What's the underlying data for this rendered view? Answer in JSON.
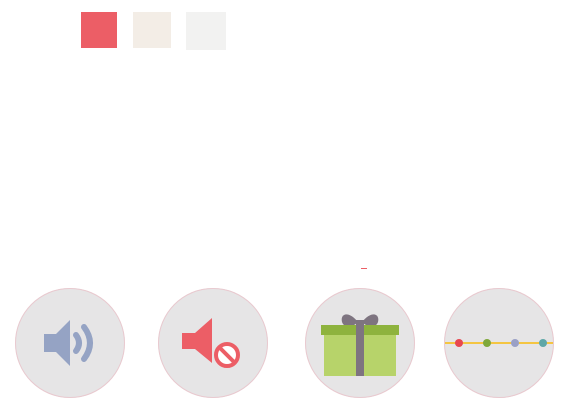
{
  "palette": {
    "swatches": [
      {
        "name": "coral",
        "color": "#ec5e66"
      },
      {
        "name": "cream",
        "color": "#f3ede6"
      },
      {
        "name": "light-gray",
        "color": "#f2f2f1"
      }
    ]
  },
  "accent_mark_color": "#ec5e66",
  "controls": {
    "sound_icon": "speaker-icon",
    "mute_icon": "speaker-muted-icon",
    "gift_icon": "gift-icon",
    "timeline_icon": "timeline-dots-icon"
  },
  "colors": {
    "circle_bg": "#e6e5e6",
    "speaker_blue": "#95a3c4",
    "mute_red": "#ec5e66",
    "gift_green": "#b7d36a",
    "gift_lid_green": "#8eb33e",
    "ribbon_gray": "#7e7480",
    "line_yellow": "#f4c542",
    "dot_red": "#e8474f",
    "dot_green": "#7fa83a",
    "dot_purple": "#9aa0c6",
    "dot_teal": "#5fa7a7"
  }
}
